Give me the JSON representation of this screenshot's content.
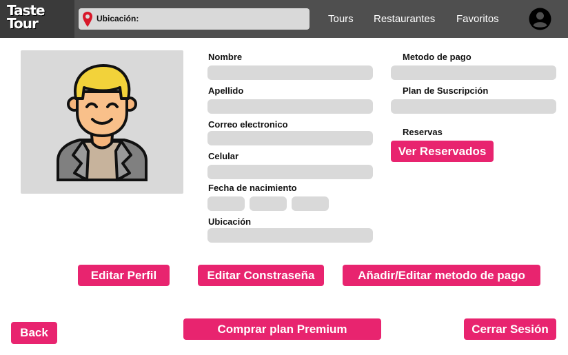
{
  "header": {
    "logo_text": "Taste\nTour",
    "search_label": "Ubicación:",
    "nav": [
      "Tours",
      "Restaurantes",
      "Favoritos"
    ]
  },
  "form": {
    "left_labels": {
      "nombre": "Nombre",
      "apellido": "Apellido",
      "correo": "Correo electronico",
      "celular": "Celular",
      "fecha": "Fecha de nacimiento",
      "ubicacion": "Ubicación"
    },
    "right_labels": {
      "metodo_pago": "Metodo de pago",
      "plan": "Plan de Suscripción",
      "reservas": "Reservas"
    },
    "ver_reservados": "Ver Reservados"
  },
  "actions": {
    "editar_perfil": "Editar Perfil",
    "editar_contrasena": "Editar Constraseña",
    "metodo_pago": "Añadir/Editar metodo de pago",
    "back": "Back",
    "premium": "Comprar plan Premium",
    "cerrar": "Cerrar Sesión"
  },
  "colors": {
    "accent": "#e8246f",
    "header": "#4f4f4f",
    "field": "#d9d9d9"
  },
  "icons": {
    "location": "map-pin-icon",
    "account": "account-circle-icon",
    "profile": "user-avatar-illustration"
  }
}
